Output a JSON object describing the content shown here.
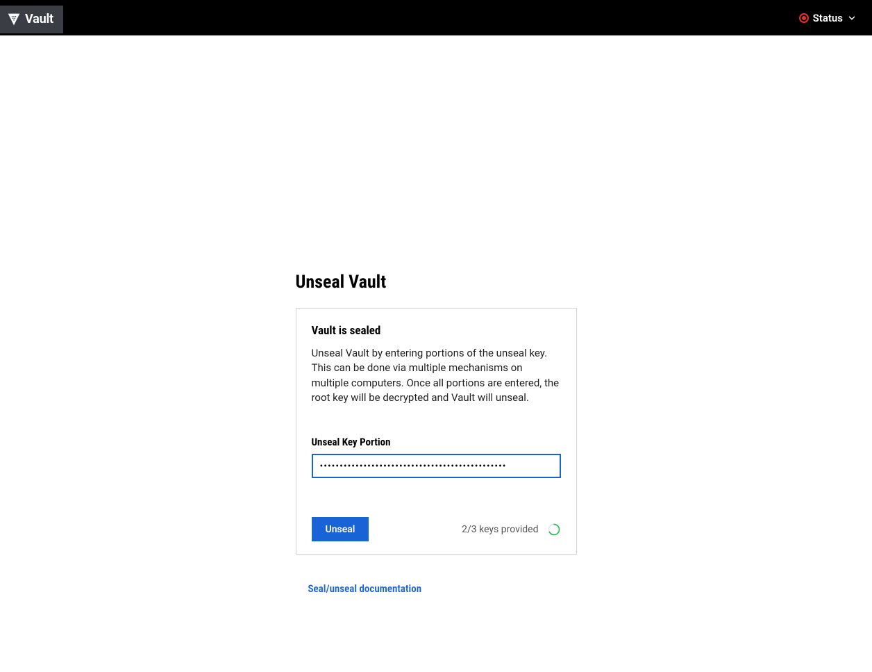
{
  "header": {
    "brand": "Vault",
    "status_label": "Status",
    "status_color": "#e03131"
  },
  "main": {
    "page_title": "Unseal Vault",
    "card_title": "Vault is sealed",
    "card_description": "Unseal Vault by entering portions of the unseal key. This can be done via multiple mechanisms on multiple computers. Once all portions are entered, the root key will be decrypted and Vault will unseal.",
    "field_label": "Unseal Key Portion",
    "input_value": "•••••••••••••••••••••••••••••••••••••••••••••••",
    "submit_label": "Unseal",
    "progress_text": "2/3 keys provided",
    "progress_current": 2,
    "progress_total": 3,
    "doc_link_label": "Seal/unseal documentation"
  },
  "colors": {
    "accent": "#1863d6",
    "progress_ring": "#2eb85c"
  }
}
